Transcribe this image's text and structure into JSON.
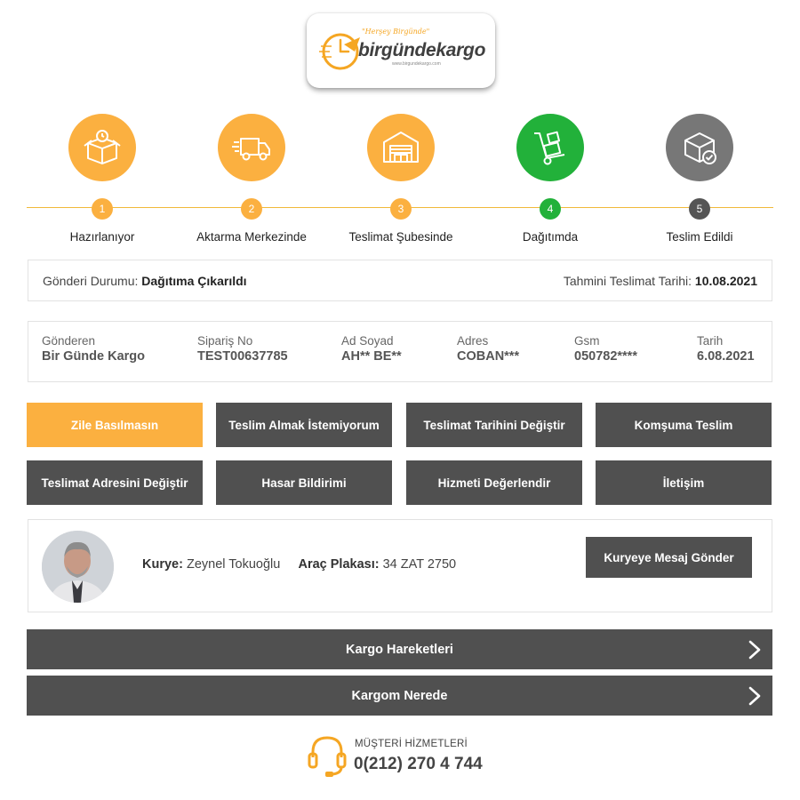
{
  "brand": {
    "tagline": "\"Herşey Birgünde\"",
    "name": "birgündekargo",
    "url": "www.birgundekargo.com",
    "accent_color": "#fbb040",
    "dark_color": "#505050",
    "green_color": "#22b13a"
  },
  "steps": [
    {
      "number": "1",
      "label": "Hazırlanıyor",
      "icon": "box-clock-icon",
      "state": "done"
    },
    {
      "number": "2",
      "label": "Aktarma Merkezinde",
      "icon": "truck-icon",
      "state": "done"
    },
    {
      "number": "3",
      "label": "Teslimat Şubesinde",
      "icon": "warehouse-icon",
      "state": "done"
    },
    {
      "number": "4",
      "label": "Dağıtımda",
      "icon": "hand-truck-icon",
      "state": "active"
    },
    {
      "number": "5",
      "label": "Teslim Edildi",
      "icon": "box-check-icon",
      "state": "pending"
    }
  ],
  "status": {
    "label": "Gönderi Durumu:",
    "value": "Dağıtıma Çıkarıldı",
    "eta_label": "Tahmini Teslimat Tarihi:",
    "eta_value": "10.08.2021"
  },
  "info": [
    {
      "label": "Gönderen",
      "value": "Bir Günde Kargo"
    },
    {
      "label": "Sipariş No",
      "value": "TEST00637785"
    },
    {
      "label": "Ad Soyad",
      "value": "AH** BE**"
    },
    {
      "label": "Adres",
      "value": "COBAN***"
    },
    {
      "label": "Gsm",
      "value": "050782****"
    },
    {
      "label": "Tarih",
      "value": "6.08.2021"
    }
  ],
  "actions": [
    "Zile Basılmasın",
    "Teslim Almak İstemiyorum",
    "Teslimat Tarihini Değiştir",
    "Komşuma Teslim",
    "Teslimat Adresini Değiştir",
    "Hasar Bildirimi",
    "Hizmeti Değerlendir",
    "İletişim"
  ],
  "courier": {
    "courier_label": "Kurye:",
    "courier_name": "Zeynel Tokuoğlu",
    "plate_label": "Araç Plakası:",
    "plate_value": "34 ZAT 2750",
    "message_button": "Kuryeye Mesaj Gönder"
  },
  "accordions": [
    {
      "label": "Kargo Hareketleri",
      "icon": "chevron-right-icon"
    },
    {
      "label": "Kargom Nerede",
      "icon": "chevron-right-icon"
    }
  ],
  "customer_service": {
    "label": "MÜŞTERİ HİZMETLERİ",
    "phone": "0(212) 270 4 744",
    "icon": "headset-icon"
  }
}
